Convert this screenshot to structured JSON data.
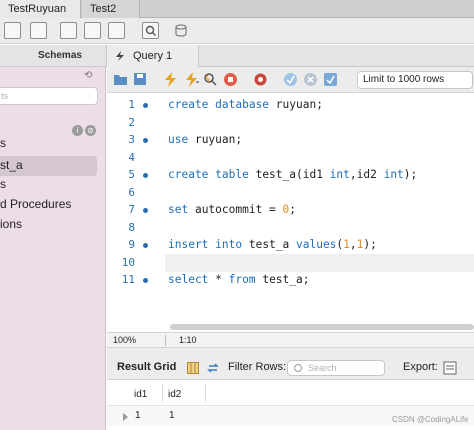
{
  "tabs": [
    {
      "label": "TestRuyuan",
      "active": true
    },
    {
      "label": "Test2",
      "active": false
    }
  ],
  "sidebar": {
    "header": "Schemas",
    "filter_placeholder": "ts",
    "items": [
      "s",
      "st_a",
      "s",
      "d Procedures",
      "ions"
    ],
    "selected_item": "st_a"
  },
  "editor": {
    "tab_label": "Query 1",
    "limit_label": "Limit to 1000 rows",
    "lines": [
      {
        "n": "1",
        "tokens": [
          {
            "t": "create ",
            "c": "kw"
          },
          {
            "t": "database ",
            "c": "kw"
          },
          {
            "t": "ruyuan;",
            "c": ""
          }
        ]
      },
      {
        "n": "2",
        "tokens": []
      },
      {
        "n": "3",
        "tokens": [
          {
            "t": "use ",
            "c": "kw"
          },
          {
            "t": "ruyuan;",
            "c": ""
          }
        ]
      },
      {
        "n": "4",
        "tokens": []
      },
      {
        "n": "5",
        "tokens": [
          {
            "t": "create ",
            "c": "kw"
          },
          {
            "t": "table ",
            "c": "kw"
          },
          {
            "t": "test_a(id1 ",
            "c": ""
          },
          {
            "t": "int",
            "c": "kw"
          },
          {
            "t": ",id2 ",
            "c": ""
          },
          {
            "t": "int",
            "c": "kw"
          },
          {
            "t": ");",
            "c": ""
          }
        ]
      },
      {
        "n": "6",
        "tokens": []
      },
      {
        "n": "7",
        "tokens": [
          {
            "t": "set ",
            "c": "kw"
          },
          {
            "t": "autocommit = ",
            "c": ""
          },
          {
            "t": "0",
            "c": "num"
          },
          {
            "t": ";",
            "c": ""
          }
        ]
      },
      {
        "n": "8",
        "tokens": []
      },
      {
        "n": "9",
        "tokens": [
          {
            "t": "insert ",
            "c": "kw"
          },
          {
            "t": "into ",
            "c": "kw"
          },
          {
            "t": "test_a ",
            "c": ""
          },
          {
            "t": "values",
            "c": "kw"
          },
          {
            "t": "(",
            "c": ""
          },
          {
            "t": "1",
            "c": "num"
          },
          {
            "t": ",",
            "c": ""
          },
          {
            "t": "1",
            "c": "num"
          },
          {
            "t": ");",
            "c": ""
          }
        ]
      },
      {
        "n": "10",
        "tokens": []
      },
      {
        "n": "11",
        "tokens": [
          {
            "t": "select ",
            "c": "kw"
          },
          {
            "t": "* ",
            "c": ""
          },
          {
            "t": "from ",
            "c": "kw"
          },
          {
            "t": "test_a;",
            "c": ""
          }
        ]
      }
    ],
    "dot_lines": [
      "1",
      "3",
      "5",
      "7",
      "9",
      "11"
    ]
  },
  "status": {
    "zoom": "100%",
    "position": "1:10"
  },
  "results": {
    "title": "Result Grid",
    "filter_label": "Filter Rows:",
    "search_placeholder": "Search",
    "export_label": "Export:",
    "columns": [
      "id1",
      "id2"
    ],
    "rows": [
      [
        "1",
        "1"
      ]
    ]
  },
  "watermark": "CSDN @CodingALife",
  "colors": {
    "keyword": "#1e6fb8",
    "number": "#e08a1e",
    "sidebar_bg": "#ecdde6"
  }
}
